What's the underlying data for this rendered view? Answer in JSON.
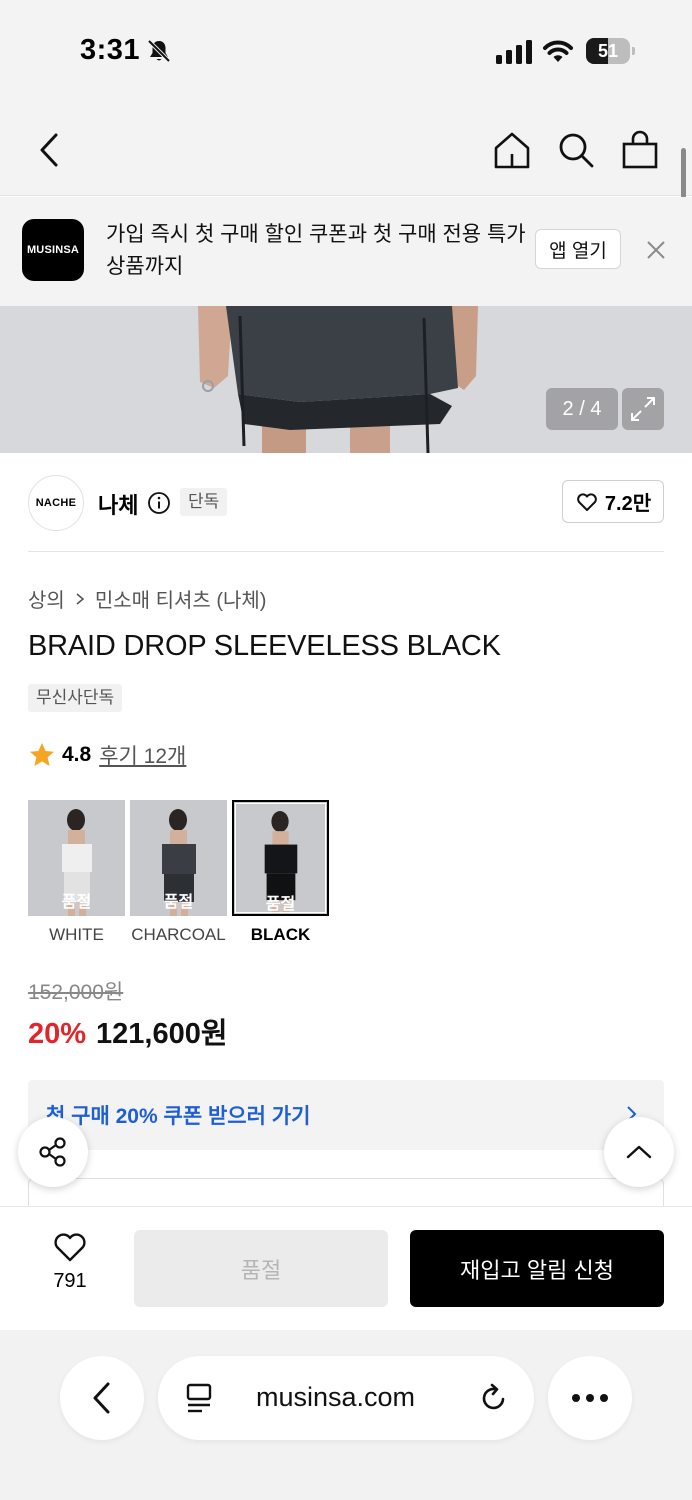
{
  "status_bar": {
    "time": "3:31",
    "battery": "51",
    "battery_level": 0.51
  },
  "app_banner": {
    "logo_text": "MUSINSA",
    "message": "가입 즉시 첫 구매 할인 쿠폰과 첫 구매 전용 특가 상품까지",
    "open_app_label": "앱 열기"
  },
  "gallery": {
    "counter": "2 / 4"
  },
  "brand": {
    "logo_text": "NACHE",
    "name": "나체",
    "exclusive_tag": "단독",
    "likes": "7.2만"
  },
  "product": {
    "breadcrumb": [
      "상의",
      "민소매 티셔츠 (나체)"
    ],
    "title": "BRAID DROP SLEEVELESS BLACK",
    "tag": "무신사단독",
    "rating": "4.8",
    "reviews_label": "후기 12개",
    "colors": [
      {
        "name": "WHITE",
        "badge": "품절",
        "selected": false
      },
      {
        "name": "CHARCOAL",
        "badge": "품절",
        "selected": false
      },
      {
        "name": "BLACK",
        "badge": "품절",
        "selected": true
      }
    ],
    "original_price": "152,000원",
    "discount": "20%",
    "price": "121,600원"
  },
  "coupon": {
    "label": "첫 구매 20% 쿠폰 받으러 가기"
  },
  "action_bar": {
    "like_count": "791",
    "soldout_label": "품절",
    "restock_label": "재입고 알림 신청"
  },
  "browser": {
    "url": "musinsa.com"
  },
  "colors": {
    "discount_red": "#e0262b",
    "coupon_blue": "#1e5fd6",
    "star": "#f5a524"
  }
}
